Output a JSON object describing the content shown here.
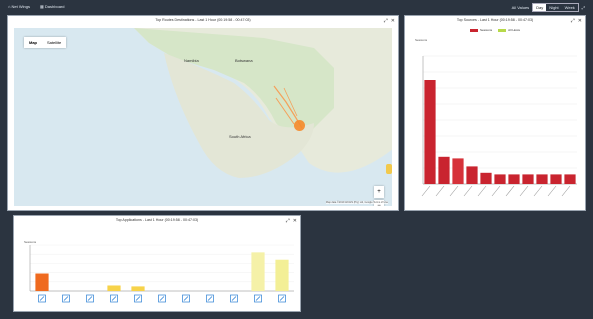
{
  "topbar": {
    "app_label": "Net Wings",
    "dashboard_label": "Dashboard",
    "range_label": "All Values",
    "toggle": [
      "Day",
      "Night",
      "Week"
    ],
    "toggle_active": 0
  },
  "map_panel": {
    "title": "Top Routes Destinations - Last 1 Hour (00:19:58 - 00:47:03)",
    "map_btn": "Map",
    "satellite_btn": "Satellite",
    "labels": [
      "Namibia",
      "Botswana",
      "South Africa"
    ],
    "zoom_in": "+",
    "zoom_out": "−",
    "attribution": "Map data ©2019 AfriGIS (Pty) Ltd, Google   Terms of Use"
  },
  "bar_panel": {
    "title": "Top Sources - Last 1 Hour (00:19:58 - 00:47:03)",
    "ylabel": "Sessions",
    "legend": [
      {
        "name": "Sessions",
        "color": "#c9242f"
      },
      {
        "name": "All Hosts",
        "color": "#b7d94a"
      }
    ]
  },
  "app_panel": {
    "title": "Top Applications - Last 1 Hour (00:19:58 - 00:47:03)",
    "ylabel": "Sessions"
  },
  "chart_data": [
    {
      "type": "bar",
      "title": "Top Sources - Last 1 Hour (00:19:58 - 00:47:03)",
      "ylabel": "Sessions",
      "ylim": [
        0,
        80
      ],
      "yticks": [
        0,
        10,
        20,
        30,
        40,
        50,
        60,
        70,
        80
      ],
      "categories": [
        "",
        "",
        "",
        "",
        "",
        "",
        "",
        "",
        "",
        "",
        ""
      ],
      "values": [
        65,
        17,
        16,
        11,
        7,
        6,
        6,
        6,
        6,
        6,
        6
      ],
      "colors": [
        "#c9242f",
        "#c9242f",
        "#d6323a",
        "#c9242f",
        "#c9242f",
        "#c9242f",
        "#c9242f",
        "#c9242f",
        "#c9242f",
        "#c9242f",
        "#c9242f"
      ]
    },
    {
      "type": "bar",
      "title": "Top Applications - Last 1 Hour (00:19:58 - 00:47:03)",
      "ylabel": "Sessions",
      "ylim": [
        0,
        5000
      ],
      "yticks": [
        0,
        1000,
        2000,
        3000,
        4000,
        5000
      ],
      "categories": [
        "",
        "",
        "",
        "",
        "",
        "",
        "",
        "",
        "",
        "",
        ""
      ],
      "values": [
        1900,
        0,
        0,
        600,
        500,
        0,
        0,
        0,
        0,
        4200,
        3400
      ],
      "colors": [
        "#ef6a1f",
        "#ef6a1f",
        "#ef6a1f",
        "#f7d34a",
        "#f7d34a",
        "#f7d34a",
        "#f7d34a",
        "#f7d34a",
        "#f7d34a",
        "#f5f1a8",
        "#f3ef96"
      ]
    }
  ]
}
